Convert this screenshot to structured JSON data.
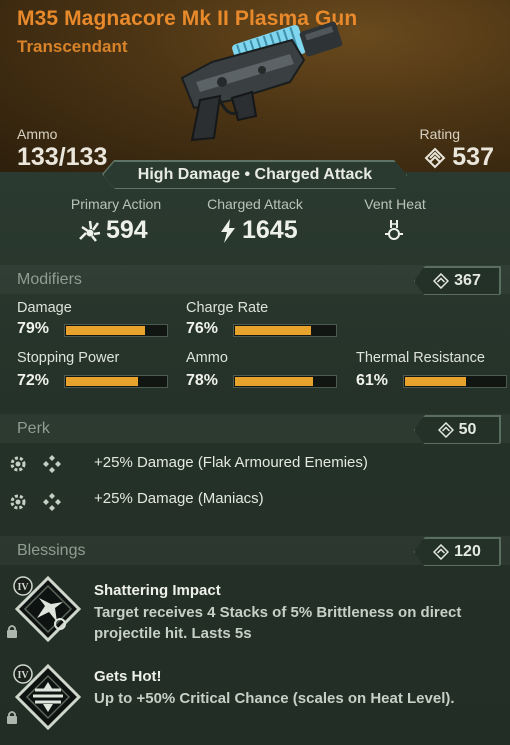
{
  "weapon": {
    "name": "M35 Magnacore Mk II Plasma Gun",
    "rarity": "Transcendant",
    "ammo_label": "Ammo",
    "ammo_value": "133/133",
    "rating_label": "Rating",
    "rating_value": "537",
    "tags": "High Damage • Charged Attack"
  },
  "actions": [
    {
      "label": "Primary Action",
      "value": "594",
      "icon": "burst-icon"
    },
    {
      "label": "Charged Attack",
      "value": "1645",
      "icon": "lightning-icon"
    },
    {
      "label": "Vent Heat",
      "value": "",
      "icon": "vent-heat-icon"
    }
  ],
  "modifiers": {
    "label": "Modifiers",
    "score": "367",
    "items": [
      {
        "label": "Damage",
        "percent": "79%",
        "value": 79
      },
      {
        "label": "Charge Rate",
        "percent": "76%",
        "value": 76
      },
      {
        "label": "Stopping Power",
        "percent": "72%",
        "value": 72
      },
      {
        "label": "Ammo",
        "percent": "78%",
        "value": 78
      },
      {
        "label": "Thermal Resistance",
        "percent": "61%",
        "value": 61
      }
    ]
  },
  "perk": {
    "label": "Perk",
    "score": "50",
    "items": [
      {
        "text": "+25% Damage (Flak Armoured Enemies)"
      },
      {
        "text": "+25%  Damage (Maniacs)"
      }
    ]
  },
  "blessings": {
    "label": "Blessings",
    "score": "120",
    "items": [
      {
        "tier": "IV",
        "title": "Shattering Impact",
        "desc": "Target receives 4 Stacks of 5% Brittleness on direct projectile hit. Lasts 5s",
        "icon": "shattering-impact-icon"
      },
      {
        "tier": "IV",
        "title": "Gets Hot!",
        "desc": "Up to +50% Critical Chance (scales on Heat Level).",
        "icon": "gets-hot-icon"
      }
    ]
  },
  "colors": {
    "accent_orange": "#e8892b",
    "bar_fill": "#e8a32c",
    "panel_green": "#253229"
  }
}
